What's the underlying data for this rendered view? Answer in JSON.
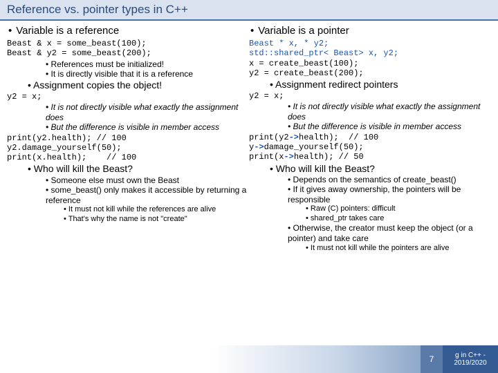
{
  "title": "Reference vs. pointer types in C++",
  "left": {
    "heading": "Variable is a reference",
    "code1": "Beast & x = some_beast(100);\nBeast & y2 = some_beast(200);",
    "b1": "References must be initialized!",
    "b2": "It is directly visible that it is a reference",
    "assign": "Assignment copies the object!",
    "code2": "y2 = x;",
    "b3": "It is not directly visible what exactly the assignment does",
    "b4": "But the difference is visible in member access",
    "code3": "print(y2.health); // 100\ny2.damage_yourself(50);\nprint(x.health);    // 100",
    "who": "Who will kill the Beast?",
    "b5": "Someone else must own the Beast",
    "b6": "some_beast() only makes it accessible by returning a reference",
    "b7": "It must not kill while the references are alive",
    "b8": "That's why the name is not \"create\""
  },
  "right": {
    "heading": "Variable is a pointer",
    "code1_a": "Beast * x, * y2;\nstd::shared_ptr< Beast> x, y2;",
    "code1_b": "x = create_beast(100);\ny2 = create_beast(200);",
    "assign": "Assignment redirect pointers",
    "code2": "y2 = x;",
    "b1": "It is not directly visible what exactly the assignment does",
    "b2": "But the difference is visible in member access",
    "code3_a": "print(y2",
    "code3_b": "health);  // 100",
    "code3_c": "y",
    "code3_d": "damage_yourself(50);",
    "code3_e": "print(x",
    "code3_f": "health); // 50",
    "who": "Who will kill the Beast?",
    "b3": "Depends on the semantics of create_beast()",
    "b4": "If it gives away ownership, the pointers will be responsible",
    "b5": "Raw (C) pointers: difficult",
    "b6": "shared_ptr takes care",
    "b7": "Otherwise, the creator must keep the object (or a pointer) and take care",
    "b8": "It must not kill while the pointers are alive"
  },
  "footer": {
    "page": "7",
    "label": "g in C++ - 2019/2020"
  }
}
